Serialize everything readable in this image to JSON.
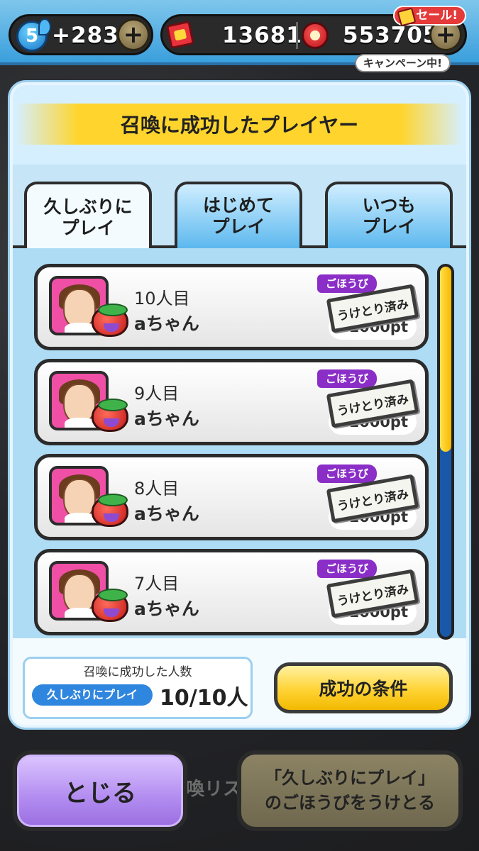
{
  "topbar": {
    "stamina_level": "5",
    "stamina_bonus": "+283",
    "plus_symbol": "+",
    "tickets": "13681",
    "coins": "553705",
    "sale_badge": "セール!",
    "campaign_badge": "キャンペーン中!"
  },
  "modal": {
    "title": "召喚に成功したプレイヤー",
    "tabs": [
      {
        "label": "久しぶりに\nプレイ",
        "active": true
      },
      {
        "label": "はじめて\nプレイ",
        "active": false
      },
      {
        "label": "いつも\nプレイ",
        "active": false
      }
    ],
    "entries": [
      {
        "rank": "10人目",
        "name": "aちゃん",
        "reward_label": "ごほうび",
        "stamp": "うけとり済み",
        "points": "1000pt"
      },
      {
        "rank": "9人目",
        "name": "aちゃん",
        "reward_label": "ごほうび",
        "stamp": "うけとり済み",
        "points": "1000pt"
      },
      {
        "rank": "8人目",
        "name": "aちゃん",
        "reward_label": "ごほうび",
        "stamp": "うけとり済み",
        "points": "1000pt"
      },
      {
        "rank": "7人目",
        "name": "aちゃん",
        "reward_label": "ごほうび",
        "stamp": "うけとり済み",
        "points": "1000pt"
      }
    ],
    "scroll_position": 0.5,
    "summary": {
      "title": "召喚に成功した人数",
      "category": "久しぶりにプレイ",
      "count": "10/10人"
    },
    "conditions_button": "成功の条件"
  },
  "bottom": {
    "close_button": "とじる",
    "behind_text": "喚リス",
    "reward_button": "「久しぶりにプレイ」\nのごほうびをうけとる"
  },
  "colors": {
    "accent_yellow": "#ffd52d",
    "tab_blue": "#5cb8ee",
    "close_purple": "#b28cf0",
    "reward_purple": "#8a2ec7"
  }
}
